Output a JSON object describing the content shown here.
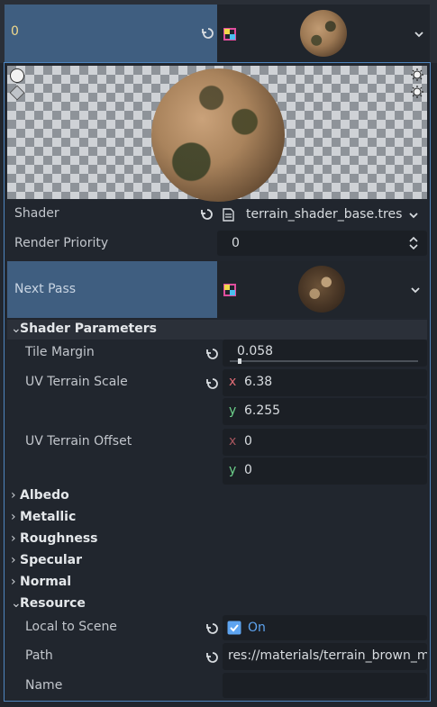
{
  "header": {
    "index_label": "0"
  },
  "shader": {
    "label": "Shader",
    "value": "terrain_shader_base.tres"
  },
  "render_priority": {
    "label": "Render Priority",
    "value": "0"
  },
  "next_pass": {
    "label": "Next Pass"
  },
  "shader_parameters": {
    "title": "Shader Parameters",
    "tile_margin": {
      "label": "Tile Margin",
      "value": "0.058",
      "slider_fraction": 0.058
    },
    "uv_terrain_scale": {
      "label": "UV Terrain Scale",
      "x_axis": "x",
      "x": "6.38",
      "y_axis": "y",
      "y": "6.255"
    },
    "uv_terrain_offset": {
      "label": "UV Terrain Offset",
      "x_axis": "x",
      "x": "0",
      "y_axis": "y",
      "y": "0"
    }
  },
  "groups": [
    "Albedo",
    "Metallic",
    "Roughness",
    "Specular",
    "Normal"
  ],
  "resource": {
    "title": "Resource",
    "local_to_scene": {
      "label": "Local to Scene",
      "value": "On",
      "checked": true
    },
    "path": {
      "label": "Path",
      "value": "res://materials/terrain_brown_m"
    },
    "name": {
      "label": "Name",
      "value": ""
    }
  },
  "colors": {
    "panel_bg": "#21262e",
    "selected_bg": "#3f5e80",
    "accent": "#5ea4f0",
    "field_bg": "#1b1f25",
    "x_axis": "#e06c75",
    "y_axis": "#6ccf8a"
  }
}
